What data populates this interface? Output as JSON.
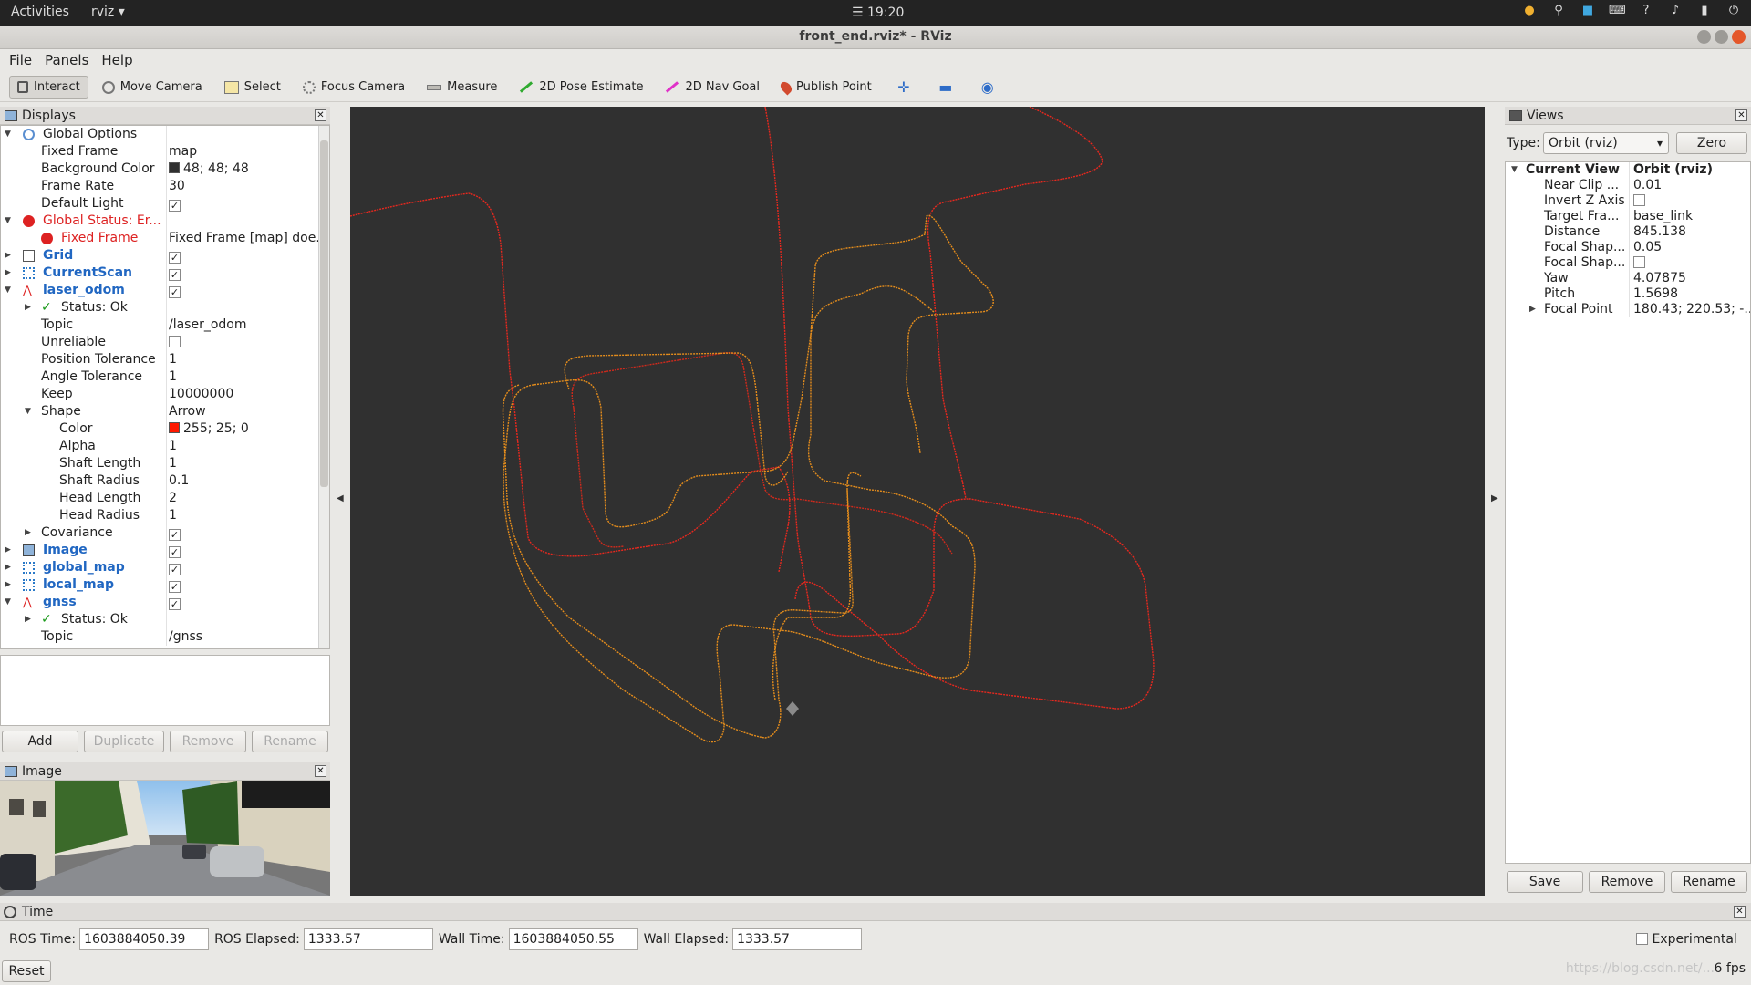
{
  "topbar": {
    "activities": "Activities",
    "app": "rviz ▾",
    "clock": "☰ 19:20",
    "tray_icons": [
      "cat-icon",
      "location-icon",
      "app-indicator-icon",
      "keyboard-icon",
      "help-icon",
      "volume-icon",
      "battery-icon",
      "power-icon"
    ]
  },
  "window": {
    "title": "front_end.rviz* - RViz"
  },
  "menu": {
    "file": "File",
    "panels": "Panels",
    "help": "Help"
  },
  "toolbar": {
    "interact": "Interact",
    "move_camera": "Move Camera",
    "select": "Select",
    "focus_camera": "Focus Camera",
    "measure": "Measure",
    "pose_estimate": "2D Pose Estimate",
    "nav_goal": "2D Nav Goal",
    "publish_point": "Publish Point",
    "plus": "✛",
    "minus": "▬",
    "eye": "◉"
  },
  "displays": {
    "title": "Displays",
    "rows": {
      "global_options": "Global Options",
      "fixed_frame_k": "Fixed Frame",
      "fixed_frame_v": "map",
      "bg_color_k": "Background Color",
      "bg_color_v": "48; 48; 48",
      "frame_rate_k": "Frame Rate",
      "frame_rate_v": "30",
      "default_light_k": "Default Light",
      "global_status": "Global Status: Er...",
      "fixed_frame_err_k": "Fixed Frame",
      "fixed_frame_err_v": "Fixed Frame [map] doe...",
      "grid": "Grid",
      "current_scan": "CurrentScan",
      "laser_odom": "laser_odom",
      "status_ok": "Status: Ok",
      "topic_k": "Topic",
      "topic_v": "/laser_odom",
      "unreliable_k": "Unreliable",
      "pos_tol_k": "Position Tolerance",
      "pos_tol_v": "1",
      "ang_tol_k": "Angle Tolerance",
      "ang_tol_v": "1",
      "keep_k": "Keep",
      "keep_v": "10000000",
      "shape_k": "Shape",
      "shape_v": "Arrow",
      "color_k": "Color",
      "color_v": "255; 25; 0",
      "alpha_k": "Alpha",
      "alpha_v": "1",
      "shaft_len_k": "Shaft Length",
      "shaft_len_v": "1",
      "shaft_rad_k": "Shaft Radius",
      "shaft_rad_v": "0.1",
      "head_len_k": "Head Length",
      "head_len_v": "2",
      "head_rad_k": "Head Radius",
      "head_rad_v": "1",
      "covariance_k": "Covariance",
      "image": "Image",
      "global_map": "global_map",
      "local_map": "local_map",
      "gnss": "gnss",
      "gnss_status": "Status: Ok",
      "gnss_topic_k": "Topic",
      "gnss_topic_v": "/gnss"
    },
    "buttons": {
      "add": "Add",
      "duplicate": "Duplicate",
      "remove": "Remove",
      "rename": "Rename"
    }
  },
  "image_panel": {
    "title": "Image"
  },
  "views": {
    "title": "Views",
    "type_label": "Type:",
    "type_value": "Orbit (rviz)",
    "zero": "Zero",
    "current_view_k": "Current View",
    "current_view_v": "Orbit (rviz)",
    "near_clip_k": "Near Clip ...",
    "near_clip_v": "0.01",
    "invert_z_k": "Invert Z Axis",
    "target_frame_k": "Target Fra...",
    "target_frame_v": "base_link",
    "distance_k": "Distance",
    "distance_v": "845.138",
    "focal_shape1_k": "Focal Shap...",
    "focal_shape1_v": "0.05",
    "focal_shape2_k": "Focal Shap...",
    "yaw_k": "Yaw",
    "yaw_v": "4.07875",
    "pitch_k": "Pitch",
    "pitch_v": "1.5698",
    "focal_point_k": "Focal Point",
    "focal_point_v": "180.43; 220.53; -...",
    "buttons": {
      "save": "Save",
      "remove": "Remove",
      "rename": "Rename"
    }
  },
  "time": {
    "title": "Time",
    "ros_time_label": "ROS Time:",
    "ros_time": "1603884050.39",
    "ros_elapsed_label": "ROS Elapsed:",
    "ros_elapsed": "1333.57",
    "wall_time_label": "Wall Time:",
    "wall_time": "1603884050.55",
    "wall_elapsed_label": "Wall Elapsed:",
    "wall_elapsed": "1333.57",
    "experimental": "Experimental",
    "reset": "Reset",
    "fps": "6 fps",
    "watermark": "https://blog.csdn.net/..."
  },
  "colors": {
    "background": "#303030",
    "laser_odom_path": "#ff1900",
    "gnss_path": "#e08a1e",
    "bg_swatch": "#303030",
    "color_swatch": "#ff1900"
  }
}
